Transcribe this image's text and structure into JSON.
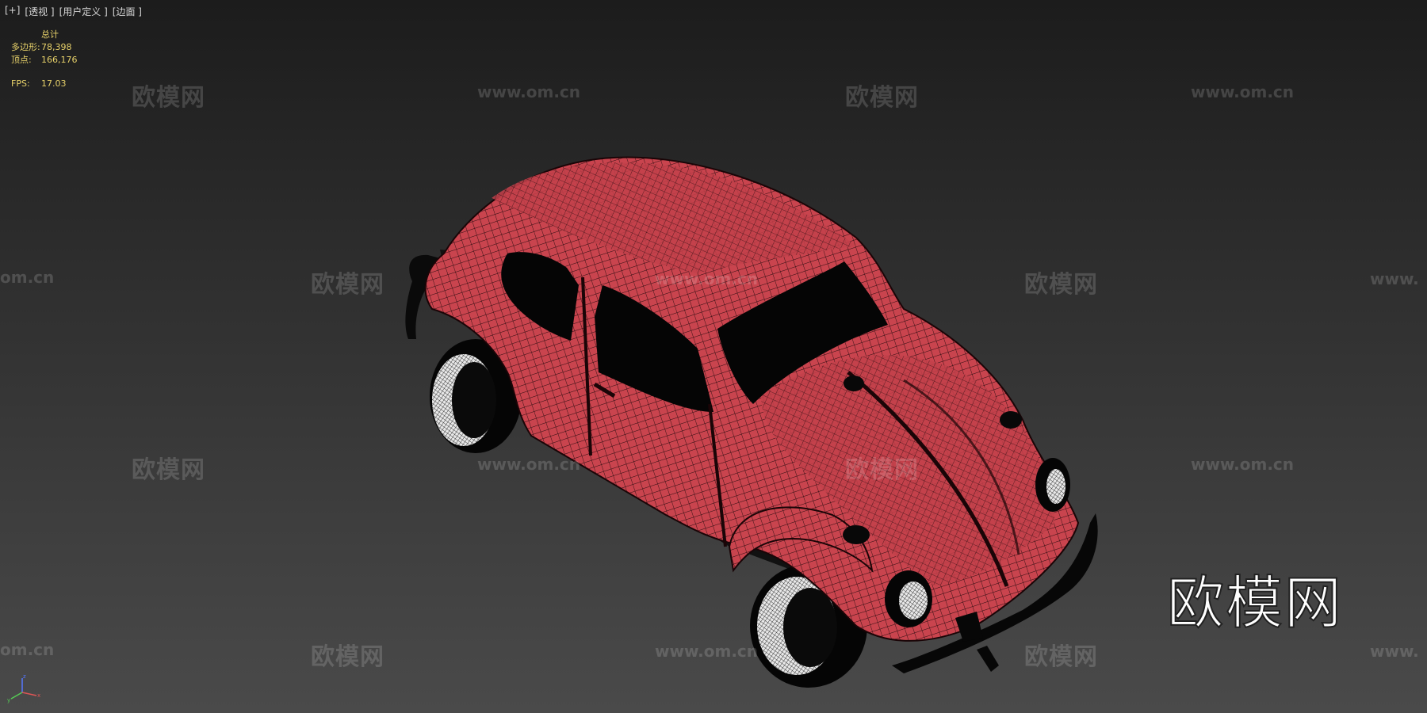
{
  "viewport": {
    "menu": {
      "plus": "[+]",
      "view": "[透视 ]",
      "shading": "[用户定义 ]",
      "edges": "[边面 ]"
    },
    "stats": {
      "header": "总计",
      "polygons_label": "多边形:",
      "polygons_value": "78,398",
      "vertices_label": "顶点:",
      "vertices_value": "166,176",
      "fps_label": "FPS:",
      "fps_value": "17.03"
    },
    "watermark": {
      "cn": "欧模网",
      "url": "www.om.cn",
      "url_partial_left": "om.cn",
      "url_partial_right": "www."
    },
    "logo": "欧模网",
    "colors": {
      "stats_text": "#e8d26a",
      "car_body": "#c9444e",
      "wire": "#2a0c10"
    }
  }
}
